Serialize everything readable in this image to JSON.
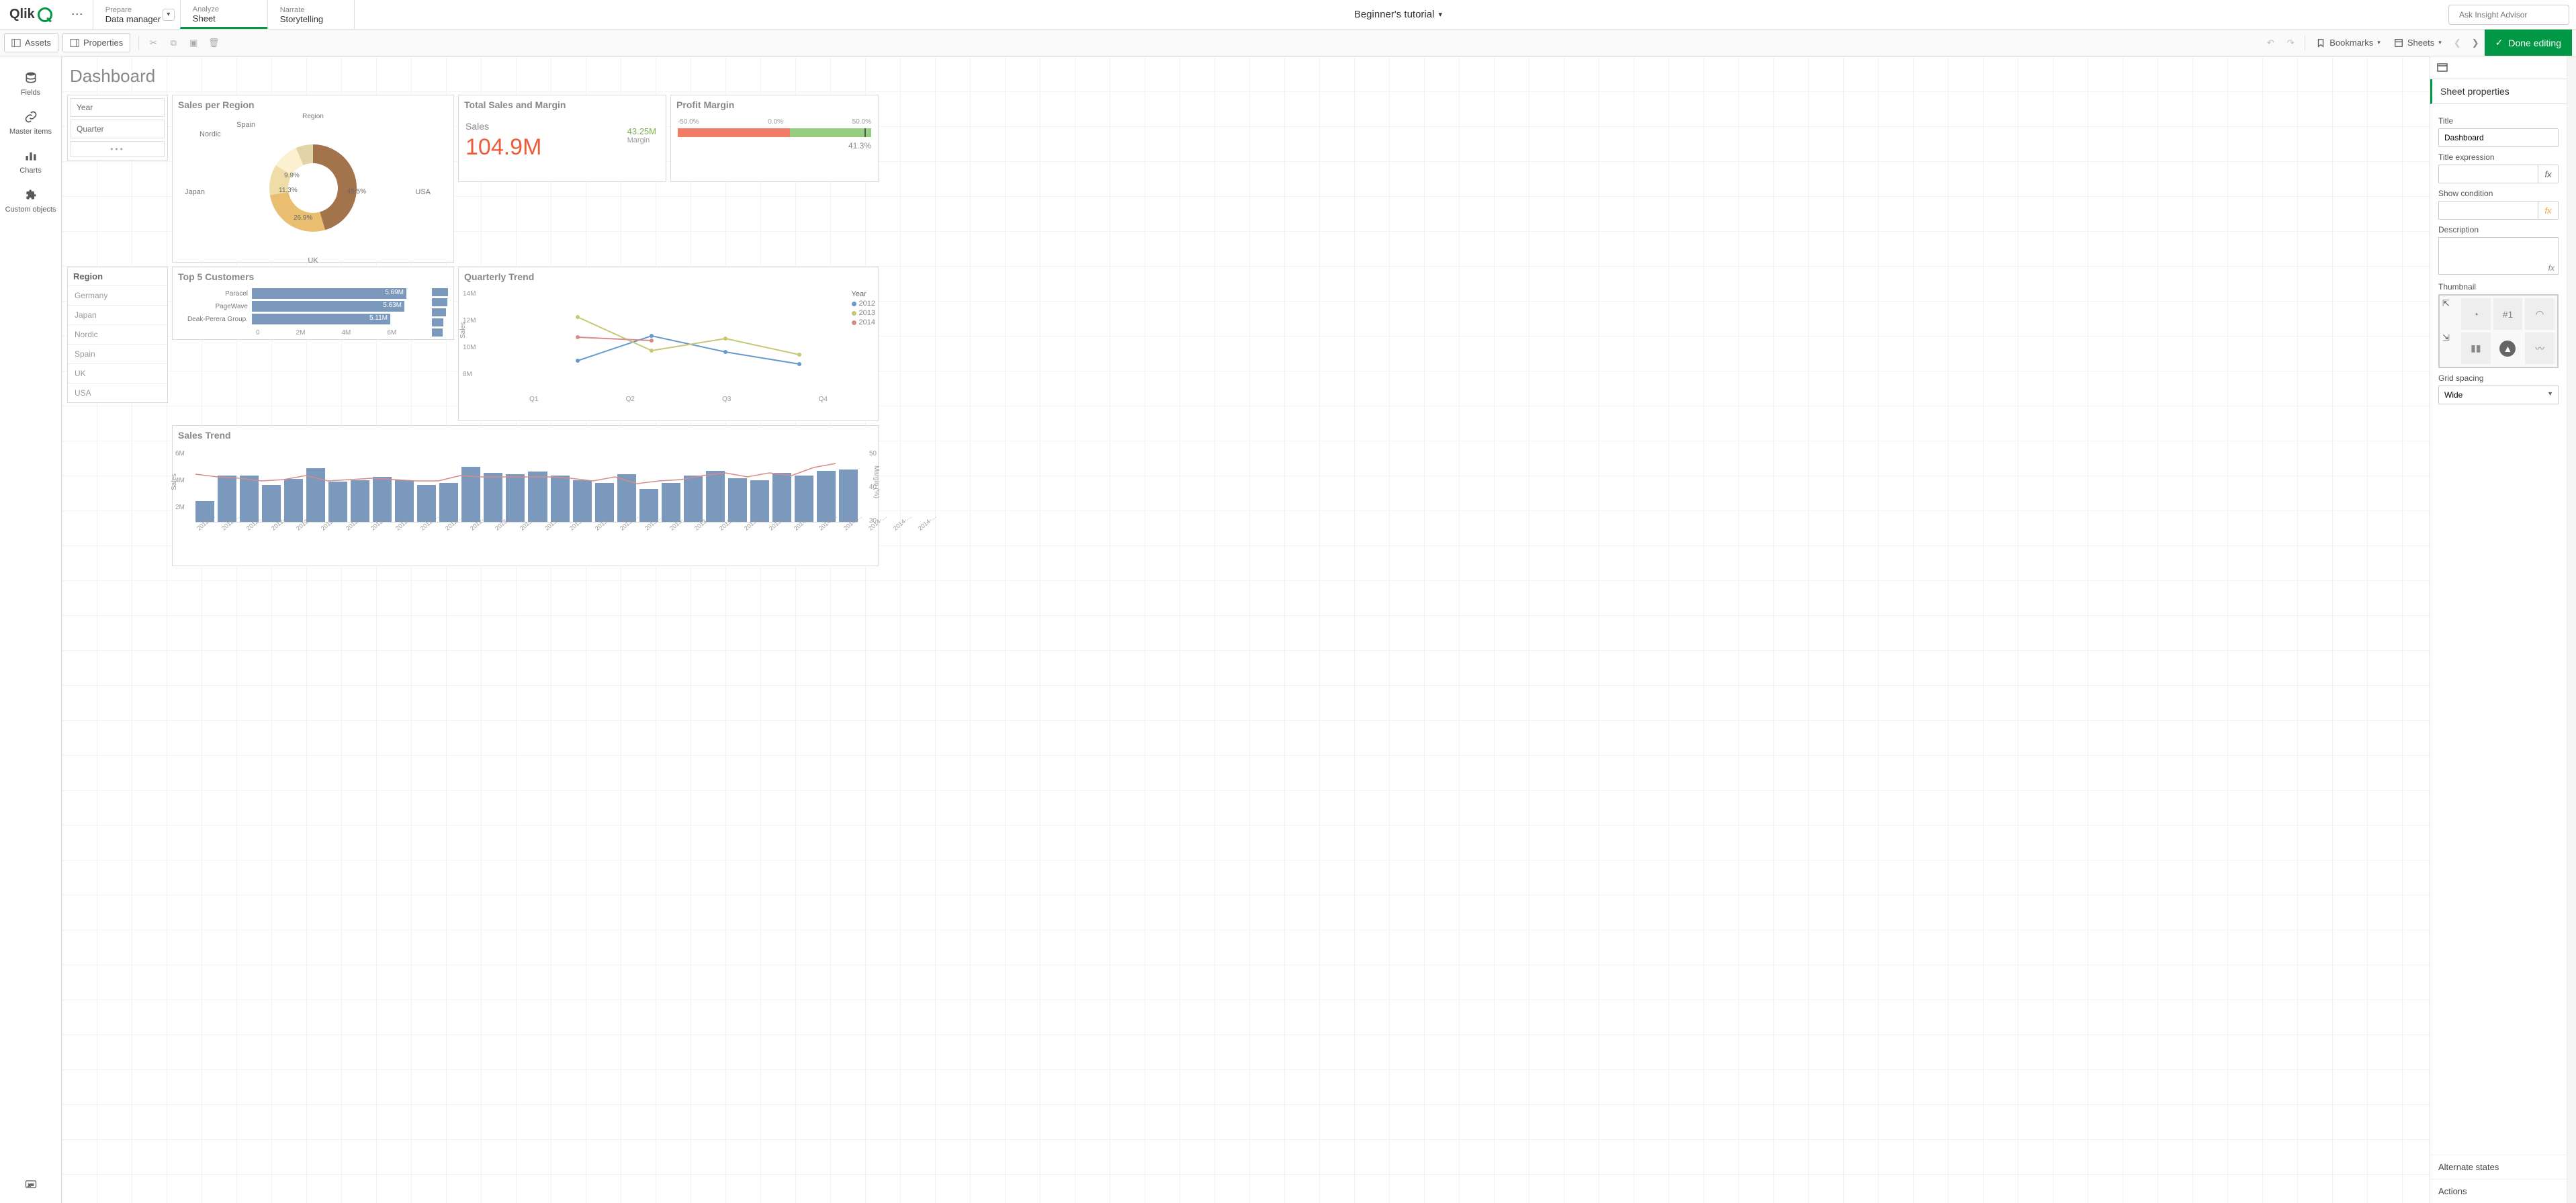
{
  "app": {
    "title": "Beginner's tutorial"
  },
  "nav": {
    "prepare": {
      "small": "Prepare",
      "big": "Data manager"
    },
    "analyze": {
      "small": "Analyze",
      "big": "Sheet"
    },
    "narrate": {
      "small": "Narrate",
      "big": "Storytelling"
    }
  },
  "search": {
    "placeholder": "Ask Insight Advisor"
  },
  "toolbar": {
    "assets": "Assets",
    "properties": "Properties",
    "bookmarks": "Bookmarks",
    "sheets": "Sheets",
    "done": "Done editing"
  },
  "rail": {
    "fields": "Fields",
    "master": "Master items",
    "charts": "Charts",
    "custom": "Custom objects"
  },
  "dashboard": {
    "title": "Dashboard"
  },
  "filters": {
    "year": "Year",
    "quarter": "Quarter",
    "region_title": "Region",
    "regions": [
      "Germany",
      "Japan",
      "Nordic",
      "Spain",
      "UK",
      "USA"
    ]
  },
  "sales_region": {
    "title": "Sales per Region",
    "legend": "Region",
    "labels": {
      "usa": "USA",
      "uk": "UK",
      "japan": "Japan",
      "nordic": "Nordic",
      "spain": "Spain"
    },
    "pct": {
      "usa": "45.5%",
      "uk": "26.9%",
      "japan": "11.3%",
      "nordic": "9.9%"
    }
  },
  "kpi": {
    "title": "Total Sales and Margin",
    "label": "Sales",
    "value": "104.9M",
    "sub_value": "43.25M",
    "sub_label": "Margin"
  },
  "gauge": {
    "title": "Profit Margin",
    "min": "-50.0%",
    "mid": "0.0%",
    "max": "50.0%",
    "value": "41.3%"
  },
  "top5": {
    "title": "Top 5 Customers",
    "rows": [
      {
        "n": "Paracel",
        "v": "5.69M",
        "w": 97
      },
      {
        "n": "PageWave",
        "v": "5.63M",
        "w": 96
      },
      {
        "n": "Deak-Perera Group.",
        "v": "5.11M",
        "w": 87
      }
    ],
    "axis": [
      "0",
      "2M",
      "4M",
      "6M"
    ]
  },
  "quarterly": {
    "title": "Quarterly Trend",
    "ylabel": "Sales",
    "yticks": [
      "14M",
      "12M",
      "10M",
      "8M"
    ],
    "xticks": [
      "Q1",
      "Q2",
      "Q3",
      "Q4"
    ],
    "legend_title": "Year",
    "legend": [
      "2012",
      "2013",
      "2014"
    ]
  },
  "trend": {
    "title": "Sales Trend",
    "yl_label": "Sales",
    "yr_label": "Margin (%)",
    "yticks_l": [
      "6M",
      "4M",
      "2M"
    ],
    "yticks_r": [
      "50",
      "40",
      "30"
    ],
    "periods": [
      "2012-…",
      "2012-…",
      "2012-…",
      "2012-…",
      "2012-…",
      "2012-…",
      "2012-…",
      "2012-…",
      "2012-…",
      "2012-…",
      "2012-…",
      "2012-…",
      "2013-…",
      "2013-…",
      "2013-…",
      "2013-…",
      "2013-…",
      "2013-…",
      "2013-…",
      "2013-…",
      "2013-…",
      "2013-…",
      "2013-…",
      "2013-…",
      "2014-…",
      "2014-…",
      "2014-…",
      "2014-…",
      "2014-…",
      "2014-…"
    ]
  },
  "props": {
    "section": "Sheet properties",
    "title_label": "Title",
    "title_value": "Dashboard",
    "title_expr_label": "Title expression",
    "show_cond_label": "Show condition",
    "desc_label": "Description",
    "thumb_label": "Thumbnail",
    "thumb_text": "#1",
    "grid_label": "Grid spacing",
    "grid_value": "Wide",
    "alt_states": "Alternate states",
    "actions": "Actions"
  },
  "chart_data": [
    {
      "type": "pie",
      "title": "Sales per Region",
      "categories": [
        "USA",
        "UK",
        "Japan",
        "Nordic",
        "Spain"
      ],
      "values": [
        45.5,
        26.9,
        11.3,
        9.9,
        6.4
      ],
      "unit": "% of Sales"
    },
    {
      "type": "bar",
      "title": "Top 5 Customers",
      "categories": [
        "Paracel",
        "PageWave",
        "Deak-Perera Group."
      ],
      "values": [
        5.69,
        5.63,
        5.11
      ],
      "unit": "M",
      "xlim": [
        0,
        6
      ]
    },
    {
      "type": "line",
      "title": "Quarterly Trend",
      "xlabel": "",
      "ylabel": "Sales",
      "categories": [
        "Q1",
        "Q2",
        "Q3",
        "Q4"
      ],
      "series": [
        {
          "name": "2012",
          "values": [
            9.6,
            11.0,
            10.1,
            9.5
          ]
        },
        {
          "name": "2013",
          "values": [
            12.2,
            10.2,
            10.9,
            9.8
          ]
        },
        {
          "name": "2014",
          "values": [
            11.0,
            10.8,
            null,
            null
          ]
        }
      ],
      "ylim": [
        8,
        14
      ],
      "unit": "M"
    },
    {
      "type": "bar",
      "title": "Sales Trend",
      "ylabel": "Sales",
      "y2label": "Margin (%)",
      "categories": [
        "2012-01",
        "2012-02",
        "2012-03",
        "2012-04",
        "2012-05",
        "2012-06",
        "2012-07",
        "2012-08",
        "2012-09",
        "2012-10",
        "2012-11",
        "2012-12",
        "2013-01",
        "2013-02",
        "2013-03",
        "2013-04",
        "2013-05",
        "2013-06",
        "2013-07",
        "2013-08",
        "2013-09",
        "2013-10",
        "2013-11",
        "2013-12",
        "2014-01",
        "2014-02",
        "2014-03",
        "2014-04",
        "2014-05",
        "2014-06"
      ],
      "series": [
        {
          "name": "Sales",
          "values": [
            1.7,
            3.8,
            3.8,
            3.0,
            3.5,
            4.4,
            3.3,
            3.4,
            3.7,
            3.4,
            3.0,
            3.2,
            4.5,
            4.0,
            3.9,
            4.1,
            3.8,
            3.4,
            3.2,
            3.9,
            2.7,
            3.2,
            3.8,
            4.2,
            3.6,
            3.4,
            4.0,
            3.8,
            4.2,
            4.3
          ]
        },
        {
          "name": "Margin (%)",
          "values": [
            44,
            42,
            41,
            40,
            41,
            43,
            40,
            41,
            42,
            41,
            40,
            40,
            43,
            42,
            42,
            42,
            42,
            41,
            40,
            42,
            39,
            40,
            41,
            43,
            44,
            42,
            44,
            43,
            46,
            47
          ]
        }
      ],
      "ylim": [
        0,
        6
      ],
      "y2lim": [
        30,
        50
      ]
    },
    {
      "type": "table",
      "title": "Profit Margin gauge",
      "min": -50,
      "max": 50,
      "value": 41.3,
      "unit": "%"
    }
  ]
}
